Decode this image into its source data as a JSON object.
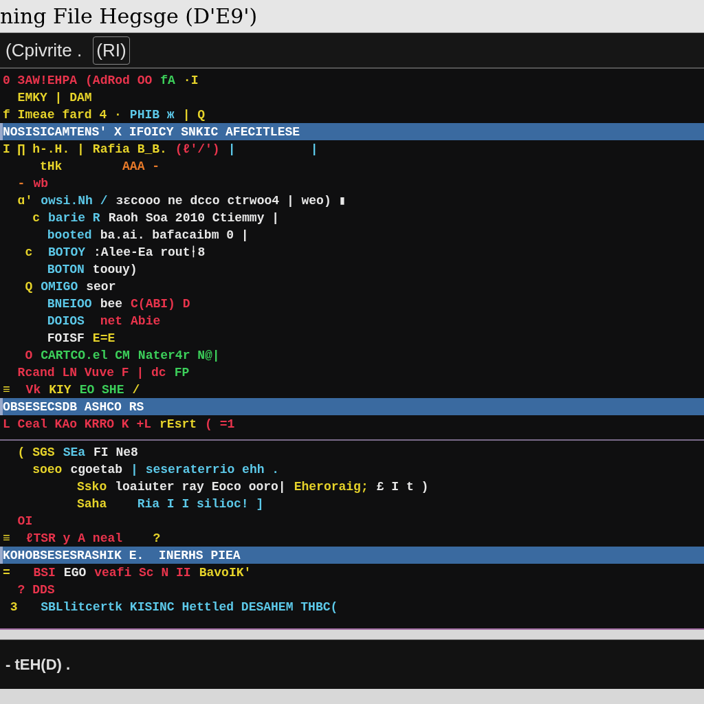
{
  "window": {
    "title": "ning File Hegsge (D'E9')"
  },
  "tab_bar": {
    "label": "(Cpivrite .",
    "badge": "(RI)"
  },
  "lines": [
    {
      "kind": "code",
      "tokens": [
        {
          "text": "0 ЗAW!EHPA",
          "color": "#e8344c"
        },
        {
          "text": "(AdRod OO",
          "color": "#e8344c"
        },
        {
          "text": "fA",
          "color": "#3ccf5a"
        },
        {
          "text": "·I",
          "color": "#e6d32a"
        }
      ]
    },
    {
      "kind": "code",
      "tokens": [
        {
          "text": "  EMKY | DAM",
          "color": "#e6d32a"
        }
      ]
    },
    {
      "kind": "code",
      "tokens": [
        {
          "text": "f Imeae fard 4 ·",
          "color": "#e6d32a"
        },
        {
          "text": "PHIB ж",
          "color": "#5cc8e8"
        },
        {
          "text": "| Q",
          "color": "#e6d32a"
        }
      ]
    },
    {
      "kind": "highlight",
      "tokens": [
        {
          "text": "NOSISICAMTENS' X IFOICY SNKIC AFECITLESE",
          "color": "#ffffff"
        }
      ]
    },
    {
      "kind": "code",
      "tokens": [
        {
          "text": "I ∏ h-.H. |",
          "color": "#e6d32a"
        },
        {
          "text": "Rafia B_B.",
          "color": "#e6d32a"
        },
        {
          "text": "(ℓ'/')",
          "color": "#e8344c"
        },
        {
          "text": "|",
          "color": "#5cc8e8"
        },
        {
          "text": "         |",
          "color": "#5cc8e8"
        }
      ]
    },
    {
      "kind": "code",
      "tokens": [
        {
          "text": "     tHk",
          "color": "#e6d32a"
        },
        {
          "text": "       AAA -",
          "color": "#e87a2a"
        }
      ]
    },
    {
      "kind": "code",
      "tokens": [
        {
          "text": "  -",
          "color": "#e87a2a"
        },
        {
          "text": "wb",
          "color": "#e8344c"
        }
      ]
    },
    {
      "kind": "code",
      "tokens": [
        {
          "text": "  ɑ'",
          "color": "#e6d32a"
        },
        {
          "text": "owsi.Nh /",
          "color": "#5cc8e8"
        },
        {
          "text": "ɜɛcooo ne dcco ctrwoo4 | weo) ▮",
          "color": "#e8e8e8"
        }
      ]
    },
    {
      "kind": "code",
      "tokens": [
        {
          "text": "    c",
          "color": "#e6d32a"
        },
        {
          "text": "barie R",
          "color": "#5cc8e8"
        },
        {
          "text": "Raoh Soa 2010 Ctiemmy |",
          "color": "#e8e8e8"
        }
      ]
    },
    {
      "kind": "code",
      "tokens": [
        {
          "text": "      booted",
          "color": "#5cc8e8"
        },
        {
          "text": "ba.ai. bafacaibm 0 |",
          "color": "#e8e8e8"
        }
      ]
    },
    {
      "kind": "code",
      "tokens": [
        {
          "text": "   c",
          "color": "#e6d32a"
        },
        {
          "text": " BOTOY",
          "color": "#5cc8e8"
        },
        {
          "text": ":Alee-Ea routᛂ8",
          "color": "#e8e8e8"
        }
      ]
    },
    {
      "kind": "code",
      "tokens": [
        {
          "text": "      BOTON",
          "color": "#5cc8e8"
        },
        {
          "text": "toouy)",
          "color": "#e8e8e8"
        }
      ]
    },
    {
      "kind": "code",
      "tokens": [
        {
          "text": "   Q",
          "color": "#e6d32a"
        },
        {
          "text": "OMIGO",
          "color": "#5cc8e8"
        },
        {
          "text": "seor",
          "color": "#e8e8e8"
        }
      ]
    },
    {
      "kind": "code",
      "tokens": [
        {
          "text": "      BNEIOO",
          "color": "#5cc8e8"
        },
        {
          "text": "bee",
          "color": "#e8e8e8"
        },
        {
          "text": "C(ABI) D",
          "color": "#e8344c"
        }
      ]
    },
    {
      "kind": "code",
      "tokens": [
        {
          "text": "      DOIOS",
          "color": "#5cc8e8"
        },
        {
          "text": " net",
          "color": "#e8344c"
        },
        {
          "text": "Abie",
          "color": "#e8344c"
        }
      ]
    },
    {
      "kind": "code",
      "tokens": [
        {
          "text": "      FOISF",
          "color": "#e8e8e8"
        },
        {
          "text": "E=E",
          "color": "#e6d32a"
        }
      ]
    },
    {
      "kind": "code",
      "tokens": [
        {
          "text": "   O",
          "color": "#e8344c"
        },
        {
          "text": "CARTCO.el CM",
          "color": "#3ccf5a"
        },
        {
          "text": "Nater4r N@|",
          "color": "#3ccf5a"
        }
      ]
    },
    {
      "kind": "code",
      "tokens": [
        {
          "text": "  Rcand LN Vuve F | dc",
          "color": "#e8344c"
        },
        {
          "text": "FP",
          "color": "#3ccf5a"
        }
      ]
    },
    {
      "kind": "code",
      "tokens": [
        {
          "text": "≡",
          "color": "#e6d32a"
        },
        {
          "text": " Vk",
          "color": "#e8344c"
        },
        {
          "text": "KIY",
          "color": "#e6d32a"
        },
        {
          "text": "EO SHE",
          "color": "#3ccf5a"
        },
        {
          "text": "/",
          "color": "#e6d32a"
        }
      ]
    },
    {
      "kind": "highlight",
      "tokens": [
        {
          "text": "OBSESECSDB ASHCO RS",
          "color": "#ffffff"
        }
      ]
    },
    {
      "kind": "code",
      "tokens": [
        {
          "text": "L Ceal KAo KRRO K +L",
          "color": "#e8344c"
        },
        {
          "text": "rEsrt",
          "color": "#e6d32a"
        },
        {
          "text": "( =1",
          "color": "#e8344c"
        }
      ]
    },
    {
      "kind": "divider"
    },
    {
      "kind": "code",
      "tokens": [
        {
          "text": "  ( SGS",
          "color": "#e6d32a"
        },
        {
          "text": "SEa",
          "color": "#5cc8e8"
        },
        {
          "text": "FI Ne8",
          "color": "#e8e8e8"
        }
      ]
    },
    {
      "kind": "code",
      "tokens": [
        {
          "text": "    soeo",
          "color": "#e6d32a"
        },
        {
          "text": "cgoetab",
          "color": "#e8e8e8"
        },
        {
          "text": "| seseraterrio ehh .",
          "color": "#5cc8e8"
        }
      ]
    },
    {
      "kind": "code",
      "tokens": [
        {
          "text": "          Ssko",
          "color": "#e6d32a"
        },
        {
          "text": "loaiuter ray Eoco ooro|",
          "color": "#e8e8e8"
        },
        {
          "text": "Eheroraig;",
          "color": "#e6d32a"
        },
        {
          "text": "£ I t )",
          "color": "#e8e8e8"
        }
      ]
    },
    {
      "kind": "code",
      "tokens": [
        {
          "text": "          Saha",
          "color": "#e6d32a"
        },
        {
          "text": "   Ria I I silioc! ]",
          "color": "#5cc8e8"
        }
      ]
    },
    {
      "kind": "code",
      "tokens": [
        {
          "text": "  OI",
          "color": "#e8344c"
        }
      ]
    },
    {
      "kind": "code",
      "tokens": [
        {
          "text": "≡",
          "color": "#e6d32a"
        },
        {
          "text": " ℓTSR y A neal",
          "color": "#e8344c"
        },
        {
          "text": "   ?",
          "color": "#e6d32a"
        }
      ]
    },
    {
      "kind": "highlight",
      "tokens": [
        {
          "text": "KOHOBSESESRASHIK E.  INERHS PIEA",
          "color": "#ffffff"
        }
      ]
    },
    {
      "kind": "code",
      "tokens": [
        {
          "text": "=",
          "color": "#e6d32a"
        },
        {
          "text": "  BSI",
          "color": "#e8344c"
        },
        {
          "text": "EGO",
          "color": "#e8e8e8"
        },
        {
          "text": "veafi Sc N II",
          "color": "#e8344c"
        },
        {
          "text": "BavoIK'",
          "color": "#e6d32a"
        }
      ]
    },
    {
      "kind": "code",
      "tokens": [
        {
          "text": "  ? DDS",
          "color": "#e8344c"
        }
      ]
    },
    {
      "kind": "code",
      "tokens": [
        {
          "text": " 3",
          "color": "#e6d32a"
        },
        {
          "text": "  SBLlitcertk KISINC Hettled DESAHEM THBC(",
          "color": "#5cc8e8"
        }
      ]
    }
  ],
  "status_bar": {
    "text": "- tEH(D) ."
  }
}
